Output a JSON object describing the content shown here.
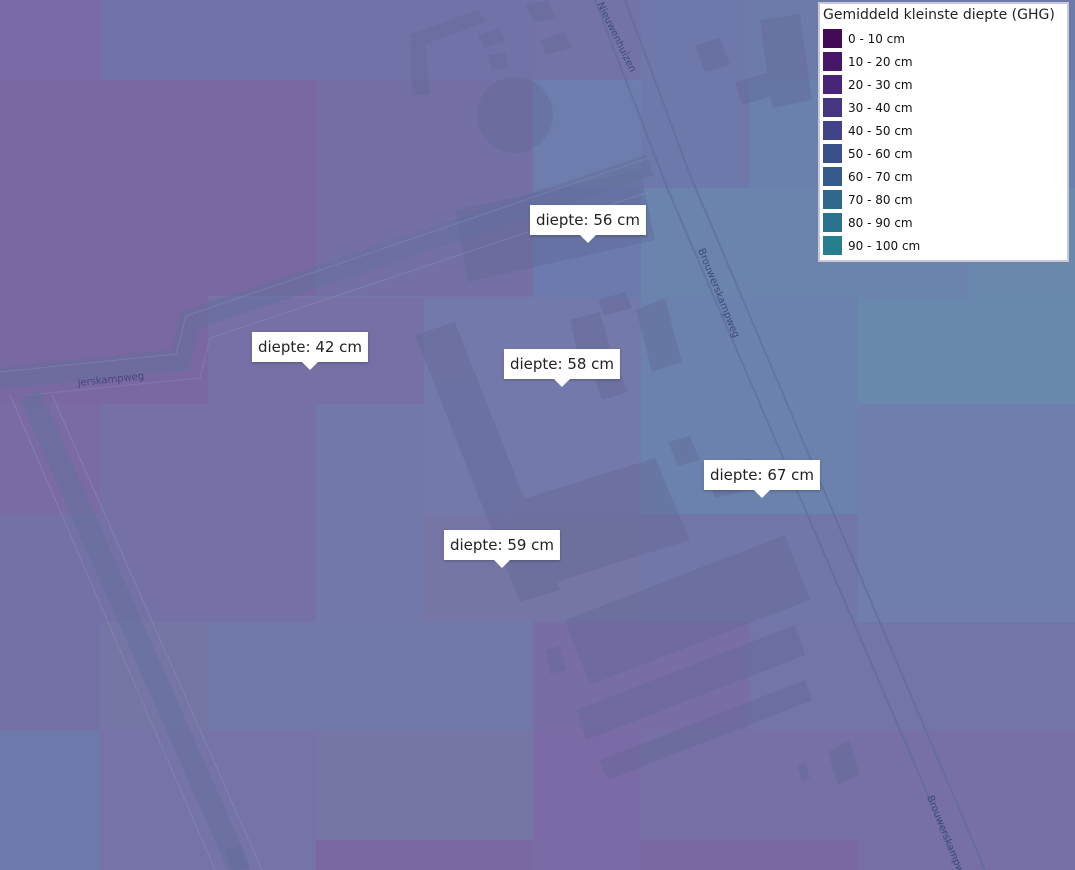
{
  "map": {
    "road_labels": [
      "Nieuwenhuizen",
      "Brouwerskampweg",
      "jerskampweg",
      "Brouwerskampw"
    ]
  },
  "callouts": [
    {
      "label": "diepte: 56 cm"
    },
    {
      "label": "diepte: 42 cm"
    },
    {
      "label": "diepte: 58 cm"
    },
    {
      "label": "diepte: 67 cm"
    },
    {
      "label": "diepte: 59 cm"
    }
  ],
  "legend": {
    "title": "Gemiddeld kleinste diepte (GHG)",
    "items": [
      {
        "label": "0 - 10 cm",
        "color": "#440a57"
      },
      {
        "label": "10 - 20 cm",
        "color": "#471668"
      },
      {
        "label": "20 - 30 cm",
        "color": "#482576"
      },
      {
        "label": "30 - 40 cm",
        "color": "#463580"
      },
      {
        "label": "40 - 50 cm",
        "color": "#414287"
      },
      {
        "label": "50 - 60 cm",
        "color": "#3b4f8a"
      },
      {
        "label": "60 - 70 cm",
        "color": "#355b8c"
      },
      {
        "label": "70 - 80 cm",
        "color": "#30678d"
      },
      {
        "label": "80 - 90 cm",
        "color": "#2b728e"
      },
      {
        "label": "90 - 100 cm",
        "color": "#277e8e"
      }
    ]
  }
}
